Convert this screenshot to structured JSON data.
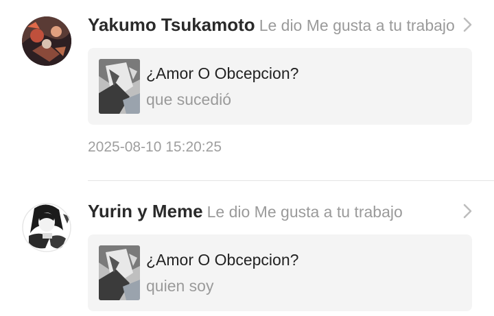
{
  "notifications": [
    {
      "username": "Yakumo Tsukamoto",
      "action": "Le dio Me gusta a tu trabajo",
      "avatar_icon": "user-avatar-dark-illustration",
      "work": {
        "title": "¿Amor O Obcepcion?",
        "comment": "que sucedió",
        "thumbnail_icon": "manga-cover-thumbnail"
      },
      "timestamp": "2025-08-10 15:20:25"
    },
    {
      "username": "Yurin y Meme",
      "action": "Le dio Me gusta a tu trabajo",
      "avatar_icon": "user-avatar-monochrome-illustration",
      "work": {
        "title": "¿Amor O Obcepcion?",
        "comment": "quien soy",
        "thumbnail_icon": "manga-cover-thumbnail"
      }
    }
  ],
  "colors": {
    "background": "#ffffff",
    "card_background": "#f4f4f4",
    "username": "#2a2a2a",
    "secondary_text": "#9a9a9a",
    "divider": "#e3e3e3"
  }
}
